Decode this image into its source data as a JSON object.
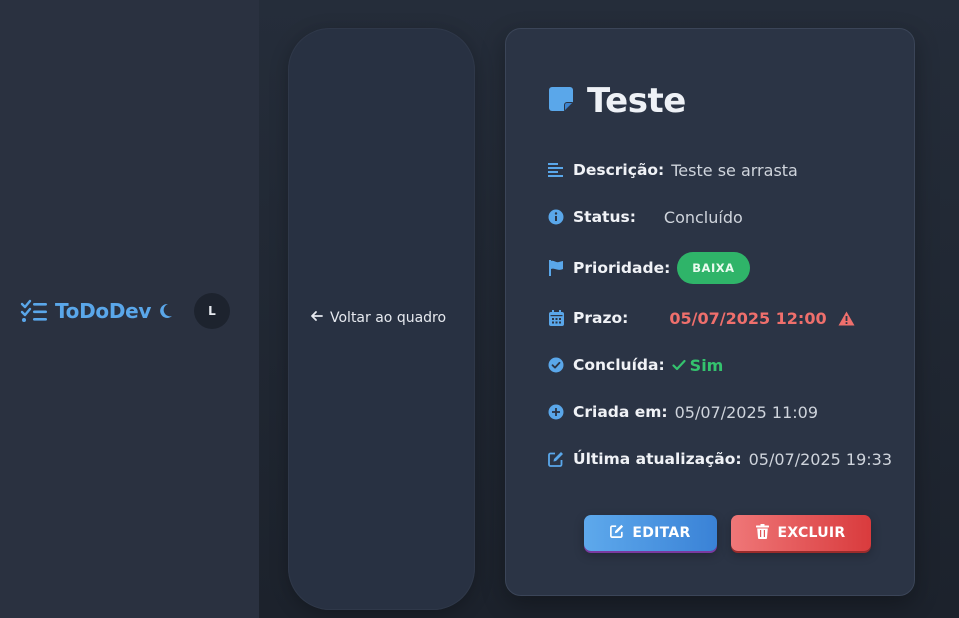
{
  "sidebar": {
    "brand": "ToDoDev",
    "brand_icon": "list-check-icon",
    "theme_icon": "moon-icon",
    "avatar_initial": "L"
  },
  "back": {
    "label": "Voltar ao quadro",
    "icon": "arrow-left-icon"
  },
  "task": {
    "title": "Teste",
    "title_icon": "sticky-note-icon",
    "fields": {
      "description": {
        "label": "Descrição:",
        "value": "Teste se arrasta",
        "icon": "align-left-icon"
      },
      "status": {
        "label": "Status:",
        "value": "Concluído",
        "icon": "info-circle-icon"
      },
      "priority": {
        "label": "Prioridade:",
        "value": "BAIXA",
        "icon": "flag-icon",
        "color": "#2fb469"
      },
      "due": {
        "label": "Prazo:",
        "value": "05/07/2025 12:00",
        "icon": "calendar-icon",
        "color": "#ef6f6c",
        "warning_icon": "warning-triangle-icon"
      },
      "done": {
        "label": "Concluída:",
        "value": "Sim",
        "icon": "check-circle-icon",
        "color": "#34c36e"
      },
      "created": {
        "label": "Criada em:",
        "value": "05/07/2025 11:09",
        "icon": "plus-circle-icon"
      },
      "updated": {
        "label": "Última atualização:",
        "value": "05/07/2025 19:33",
        "icon": "edit-icon"
      }
    },
    "actions": {
      "edit": "EDITAR",
      "delete": "EXCLUIR"
    }
  },
  "colors": {
    "accent": "#5aa7ea",
    "danger": "#e45456",
    "success": "#2fb469"
  }
}
